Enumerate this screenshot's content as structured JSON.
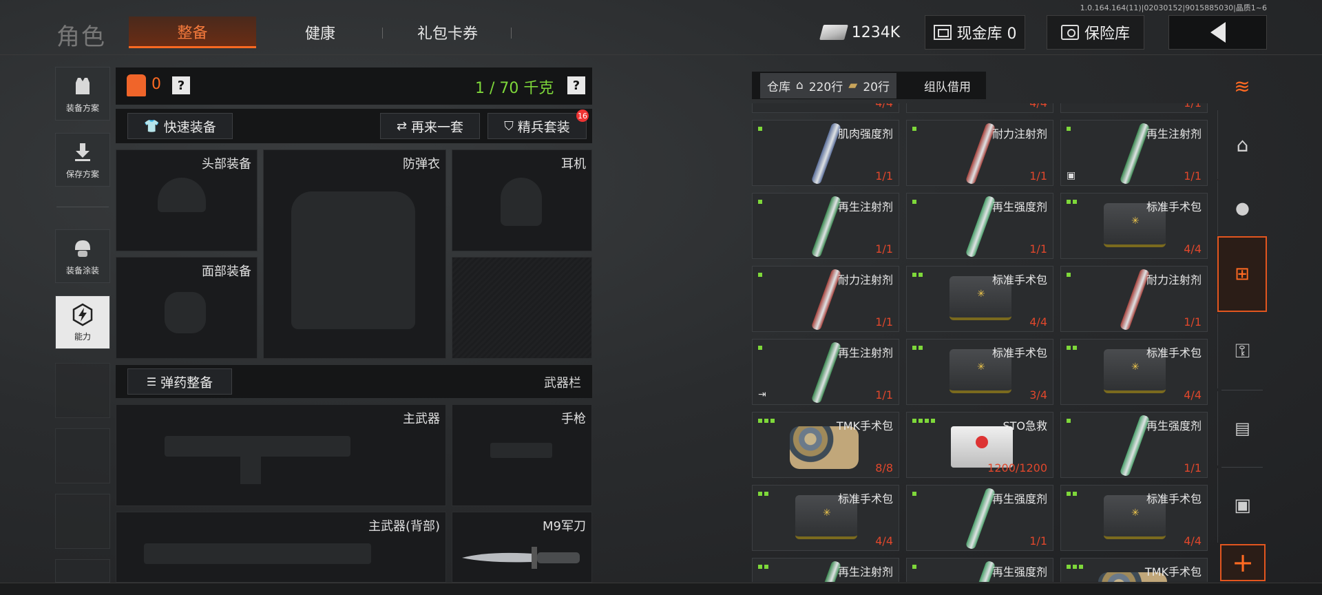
{
  "version": "1.0.164.164(11)|02030152|9015885030|晶质1~6",
  "header": {
    "title": "角色",
    "tabs": [
      {
        "label": "整备",
        "active": true
      },
      {
        "label": "健康",
        "active": false
      },
      {
        "label": "礼包卡券",
        "active": false
      }
    ],
    "money": "1234K",
    "cash_vault": "现金库 0",
    "safe": "保险库"
  },
  "left_nav": [
    {
      "label": "装备方案",
      "icon": "vest-icon"
    },
    {
      "label": "保存方案",
      "icon": "download-icon"
    },
    {
      "label": "装备涂装",
      "icon": "helmet-icon"
    },
    {
      "label": "能力",
      "icon": "ability-icon",
      "active": true
    }
  ],
  "loadout": {
    "armor_count": "0",
    "weight": "1 / 70 千克",
    "help": "?",
    "quick_equip": "快速装备",
    "reroll": "再来一套",
    "elite_set": "精兵套装",
    "elite_badge": "16",
    "slots": {
      "head": "头部装备",
      "vest": "防弹衣",
      "headset": "耳机",
      "face": "面部装备"
    },
    "ammo_button": "弹药整备",
    "weapon_bar": "武器栏",
    "weapons": {
      "primary": "主武器",
      "pistol": "手枪",
      "primary_back": "主武器(背部)",
      "melee": "M9军刀"
    }
  },
  "stash": {
    "tab_warehouse": "仓库",
    "rows_main": "220行",
    "rows_secondary": "20行",
    "tab_team": "组队借用",
    "top_partial_counts": [
      "4/4",
      "4/4",
      "1/1"
    ],
    "items": [
      {
        "name": "肌肉强度剂",
        "count": "1/1",
        "type": "syringe",
        "color": "#5a6e9a",
        "dots": 1
      },
      {
        "name": "耐力注射剂",
        "count": "1/1",
        "type": "syringe",
        "color": "#a6423c",
        "dots": 1
      },
      {
        "name": "再生注射剂",
        "count": "1/1",
        "type": "syringe",
        "color": "#3c8a52",
        "dots": 1,
        "corner": "box"
      },
      {
        "name": "再生注射剂",
        "count": "1/1",
        "type": "syringe",
        "color": "#3c8a52",
        "dots": 1
      },
      {
        "name": "再生强度剂",
        "count": "1/1",
        "type": "syringe",
        "color": "#4aa06a",
        "dots": 1
      },
      {
        "name": "标准手术包",
        "count": "4/4",
        "type": "kit",
        "dots": 2
      },
      {
        "name": "耐力注射剂",
        "count": "1/1",
        "type": "syringe",
        "color": "#a6423c",
        "dots": 1
      },
      {
        "name": "标准手术包",
        "count": "4/4",
        "type": "kit",
        "dots": 2
      },
      {
        "name": "耐力注射剂",
        "count": "1/1",
        "type": "syringe",
        "color": "#a6423c",
        "dots": 1
      },
      {
        "name": "再生注射剂",
        "count": "1/1",
        "type": "syringe",
        "color": "#3c8a52",
        "dots": 1,
        "corner": "exit"
      },
      {
        "name": "标准手术包",
        "count": "3/4",
        "type": "kit",
        "dots": 2
      },
      {
        "name": "标准手术包",
        "count": "4/4",
        "type": "kit",
        "dots": 2
      },
      {
        "name": "TMK手术包",
        "count": "8/8",
        "type": "tmk",
        "dots": 3
      },
      {
        "name": "STO急救",
        "count": "1200/1200",
        "type": "sto",
        "dots": 4
      },
      {
        "name": "再生强度剂",
        "count": "1/1",
        "type": "syringe",
        "color": "#4aa06a",
        "dots": 1
      },
      {
        "name": "标准手术包",
        "count": "4/4",
        "type": "kit",
        "dots": 2
      },
      {
        "name": "再生强度剂",
        "count": "1/1",
        "type": "syringe",
        "color": "#4aa06a",
        "dots": 1
      },
      {
        "name": "标准手术包",
        "count": "4/4",
        "type": "kit",
        "dots": 2
      },
      {
        "name": "再生注射剂",
        "count": "",
        "type": "syringe",
        "color": "#3c8a52",
        "dots": 2
      },
      {
        "name": "再生强度剂",
        "count": "",
        "type": "syringe",
        "color": "#4aa06a",
        "dots": 1
      },
      {
        "name": "TMK手术包",
        "count": "",
        "type": "tmk",
        "dots": 3
      }
    ]
  },
  "right_nav": [
    {
      "icon": "home-icon"
    },
    {
      "icon": "grenade-icon"
    },
    {
      "icon": "medkit-icon",
      "active": true
    },
    {
      "icon": "key-icon"
    },
    {
      "icon": "cash-stack-icon"
    },
    {
      "icon": "package-icon"
    }
  ]
}
